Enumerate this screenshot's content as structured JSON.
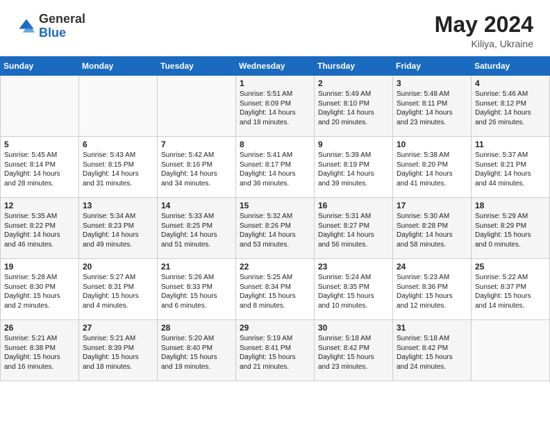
{
  "header": {
    "logo_general": "General",
    "logo_blue": "Blue",
    "month_year": "May 2024",
    "location": "Kiliya, Ukraine"
  },
  "weekdays": [
    "Sunday",
    "Monday",
    "Tuesday",
    "Wednesday",
    "Thursday",
    "Friday",
    "Saturday"
  ],
  "weeks": [
    [
      {
        "day": "",
        "text": ""
      },
      {
        "day": "",
        "text": ""
      },
      {
        "day": "",
        "text": ""
      },
      {
        "day": "1",
        "text": "Sunrise: 5:51 AM\nSunset: 8:09 PM\nDaylight: 14 hours\nand 18 minutes."
      },
      {
        "day": "2",
        "text": "Sunrise: 5:49 AM\nSunset: 8:10 PM\nDaylight: 14 hours\nand 20 minutes."
      },
      {
        "day": "3",
        "text": "Sunrise: 5:48 AM\nSunset: 8:11 PM\nDaylight: 14 hours\nand 23 minutes."
      },
      {
        "day": "4",
        "text": "Sunrise: 5:46 AM\nSunset: 8:12 PM\nDaylight: 14 hours\nand 26 minutes."
      }
    ],
    [
      {
        "day": "5",
        "text": "Sunrise: 5:45 AM\nSunset: 8:14 PM\nDaylight: 14 hours\nand 28 minutes."
      },
      {
        "day": "6",
        "text": "Sunrise: 5:43 AM\nSunset: 8:15 PM\nDaylight: 14 hours\nand 31 minutes."
      },
      {
        "day": "7",
        "text": "Sunrise: 5:42 AM\nSunset: 8:16 PM\nDaylight: 14 hours\nand 34 minutes."
      },
      {
        "day": "8",
        "text": "Sunrise: 5:41 AM\nSunset: 8:17 PM\nDaylight: 14 hours\nand 36 minutes."
      },
      {
        "day": "9",
        "text": "Sunrise: 5:39 AM\nSunset: 8:19 PM\nDaylight: 14 hours\nand 39 minutes."
      },
      {
        "day": "10",
        "text": "Sunrise: 5:38 AM\nSunset: 8:20 PM\nDaylight: 14 hours\nand 41 minutes."
      },
      {
        "day": "11",
        "text": "Sunrise: 5:37 AM\nSunset: 8:21 PM\nDaylight: 14 hours\nand 44 minutes."
      }
    ],
    [
      {
        "day": "12",
        "text": "Sunrise: 5:35 AM\nSunset: 8:22 PM\nDaylight: 14 hours\nand 46 minutes."
      },
      {
        "day": "13",
        "text": "Sunrise: 5:34 AM\nSunset: 8:23 PM\nDaylight: 14 hours\nand 49 minutes."
      },
      {
        "day": "14",
        "text": "Sunrise: 5:33 AM\nSunset: 8:25 PM\nDaylight: 14 hours\nand 51 minutes."
      },
      {
        "day": "15",
        "text": "Sunrise: 5:32 AM\nSunset: 8:26 PM\nDaylight: 14 hours\nand 53 minutes."
      },
      {
        "day": "16",
        "text": "Sunrise: 5:31 AM\nSunset: 8:27 PM\nDaylight: 14 hours\nand 56 minutes."
      },
      {
        "day": "17",
        "text": "Sunrise: 5:30 AM\nSunset: 8:28 PM\nDaylight: 14 hours\nand 58 minutes."
      },
      {
        "day": "18",
        "text": "Sunrise: 5:29 AM\nSunset: 8:29 PM\nDaylight: 15 hours\nand 0 minutes."
      }
    ],
    [
      {
        "day": "19",
        "text": "Sunrise: 5:28 AM\nSunset: 8:30 PM\nDaylight: 15 hours\nand 2 minutes."
      },
      {
        "day": "20",
        "text": "Sunrise: 5:27 AM\nSunset: 8:31 PM\nDaylight: 15 hours\nand 4 minutes."
      },
      {
        "day": "21",
        "text": "Sunrise: 5:26 AM\nSunset: 8:33 PM\nDaylight: 15 hours\nand 6 minutes."
      },
      {
        "day": "22",
        "text": "Sunrise: 5:25 AM\nSunset: 8:34 PM\nDaylight: 15 hours\nand 8 minutes."
      },
      {
        "day": "23",
        "text": "Sunrise: 5:24 AM\nSunset: 8:35 PM\nDaylight: 15 hours\nand 10 minutes."
      },
      {
        "day": "24",
        "text": "Sunrise: 5:23 AM\nSunset: 8:36 PM\nDaylight: 15 hours\nand 12 minutes."
      },
      {
        "day": "25",
        "text": "Sunrise: 5:22 AM\nSunset: 8:37 PM\nDaylight: 15 hours\nand 14 minutes."
      }
    ],
    [
      {
        "day": "26",
        "text": "Sunrise: 5:21 AM\nSunset: 8:38 PM\nDaylight: 15 hours\nand 16 minutes."
      },
      {
        "day": "27",
        "text": "Sunrise: 5:21 AM\nSunset: 8:39 PM\nDaylight: 15 hours\nand 18 minutes."
      },
      {
        "day": "28",
        "text": "Sunrise: 5:20 AM\nSunset: 8:40 PM\nDaylight: 15 hours\nand 19 minutes."
      },
      {
        "day": "29",
        "text": "Sunrise: 5:19 AM\nSunset: 8:41 PM\nDaylight: 15 hours\nand 21 minutes."
      },
      {
        "day": "30",
        "text": "Sunrise: 5:18 AM\nSunset: 8:42 PM\nDaylight: 15 hours\nand 23 minutes."
      },
      {
        "day": "31",
        "text": "Sunrise: 5:18 AM\nSunset: 8:42 PM\nDaylight: 15 hours\nand 24 minutes."
      },
      {
        "day": "",
        "text": ""
      }
    ]
  ]
}
